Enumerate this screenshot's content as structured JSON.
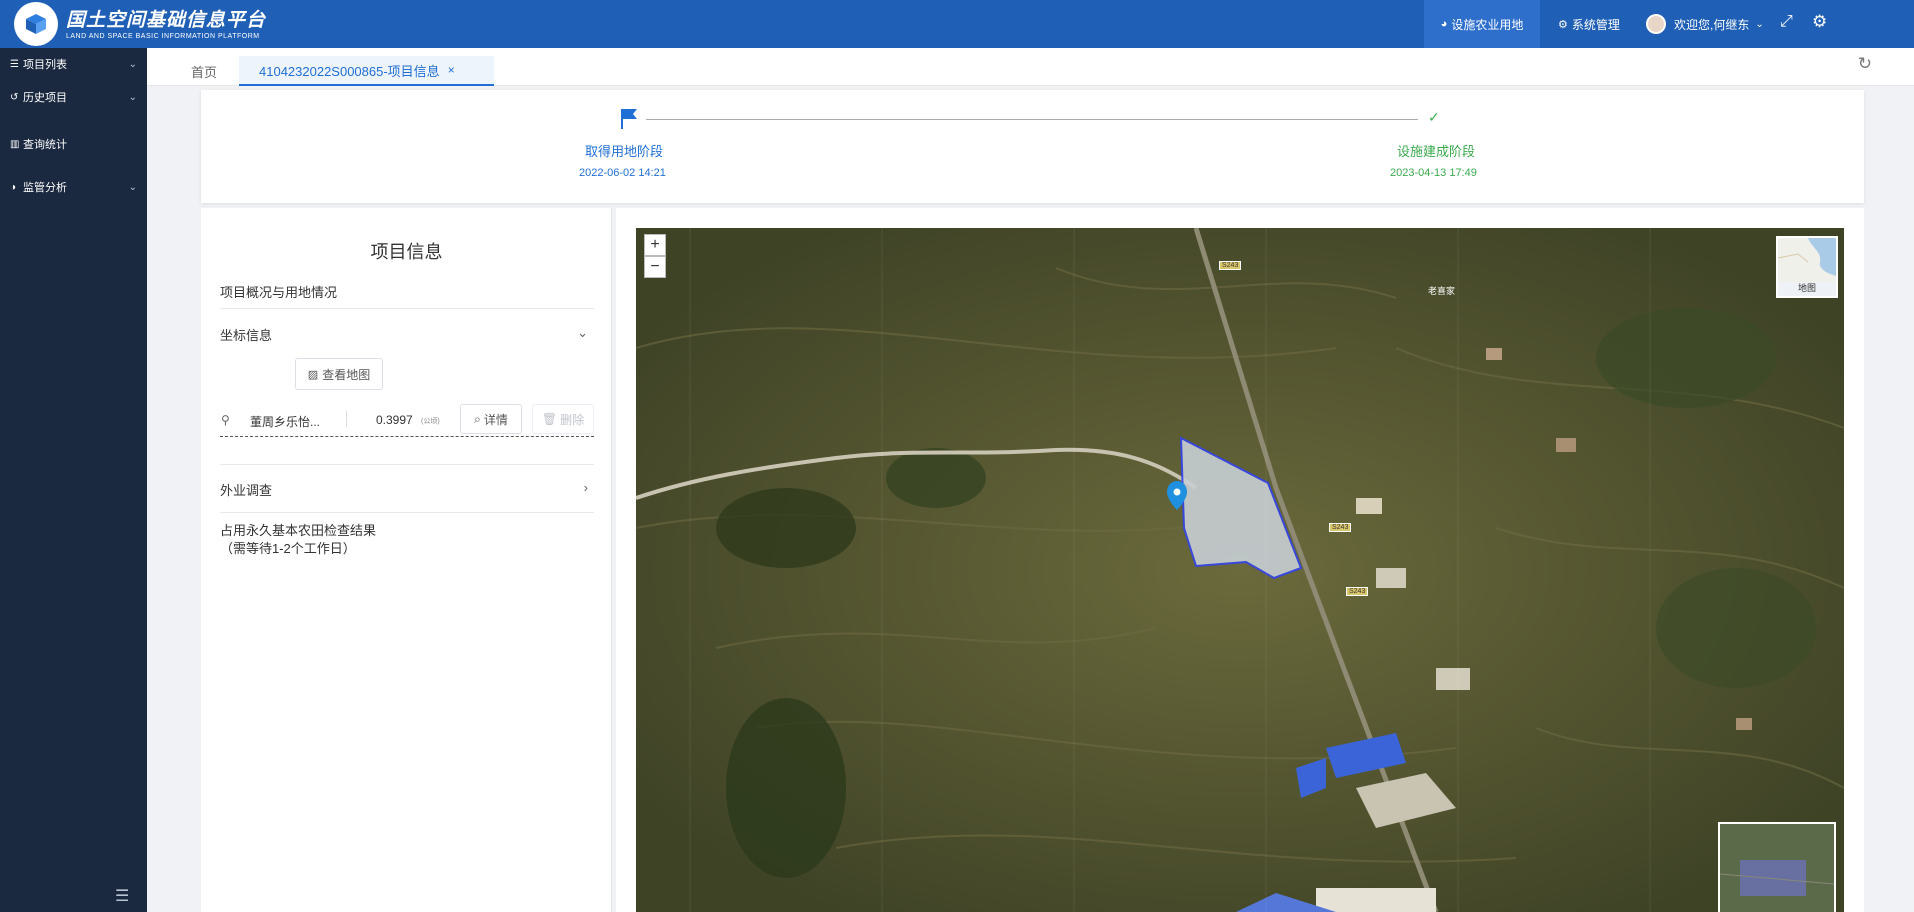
{
  "header": {
    "title": "国土空间基础信息平台",
    "subtitle": "LAND AND SPACE BASIC INFORMATION PLATFORM",
    "nav_active": "设施农业用地",
    "nav_system": "系统管理",
    "welcome": "欢迎您,何继东"
  },
  "sidebar": {
    "items": [
      {
        "label": "项目列表"
      },
      {
        "label": "历史项目"
      },
      {
        "label": "查询统计"
      },
      {
        "label": "监管分析"
      }
    ]
  },
  "tabs": {
    "home": "首页",
    "active": "4104232022S000865-项目信息",
    "close": "×"
  },
  "progress": {
    "step1_title": "取得用地阶段",
    "step1_time": "2022-06-02 14:21",
    "step2_title": "设施建成阶段",
    "step2_time": "2023-04-13 17:49"
  },
  "info": {
    "title": "项目信息",
    "overview": "项目概况与用地情况",
    "coord_section": "坐标信息",
    "view_map_btn": "查看地图",
    "coord_name": "董周乡乐怡...",
    "coord_area": "0.3997",
    "coord_unit": "(公顷)",
    "detail_btn": "详情",
    "delete_btn": "删除",
    "field_survey": "外业调查",
    "check_result_line1": "占用永久基本农田检查结果",
    "check_result_line2": "（需等待1-2个工作日）"
  },
  "map": {
    "zoom_in": "+",
    "zoom_out": "−",
    "basemap_label": "地图",
    "road_label1": "S243",
    "road_label2": "S243",
    "road_label3": "S243",
    "place_label": "老喜家"
  }
}
